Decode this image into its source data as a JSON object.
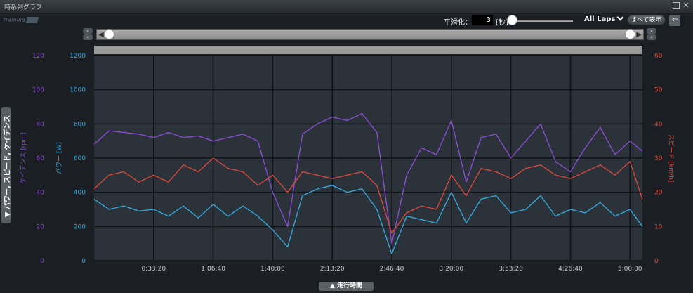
{
  "window": {
    "title": "時系列グラフ"
  },
  "logo": {
    "text": "Training"
  },
  "toolbar": {
    "smoothing_label": "平滑化：",
    "smoothing_value": "3",
    "smoothing_unit": "[秒]",
    "laps_label": "All Laps",
    "show_all_label": "すべて表示",
    "back_icon": "back-arrow-icon"
  },
  "range": {
    "pan_right": "»",
    "pan_left": "«",
    "left_arrow": "◀",
    "right_arrow": "▶"
  },
  "side_tab": {
    "label": "▼ パワー, スピード, ケイデンス"
  },
  "bottom_tab": {
    "label": "▲ 走行時間"
  },
  "colors": {
    "cadence": "#8d4fd6",
    "power": "#33aee0",
    "speed": "#e0493d",
    "bg": "#2c323a",
    "grid": "#0f1216"
  },
  "chart_data": {
    "type": "line",
    "xlabel": "走行時間",
    "x_unit": "seconds",
    "xlim": [
      0,
      18420
    ],
    "x_ticks": [
      "0:33:20",
      "1:06:40",
      "1:40:00",
      "2:13:20",
      "2:46:40",
      "3:20:00",
      "3:53:20",
      "4:26:40",
      "5:00:00"
    ],
    "x_tick_values": [
      2000,
      4000,
      6000,
      8000,
      10000,
      12000,
      14000,
      16000,
      18000
    ],
    "axes": {
      "cadence": {
        "label": "ケイデンス [rpm]",
        "ticks": [
          "0",
          "20",
          "40",
          "60",
          "80",
          "100",
          "120"
        ],
        "ylim": [
          0,
          120
        ]
      },
      "power": {
        "label": "パワー [W]",
        "ticks": [
          "0",
          "200",
          "400",
          "600",
          "800",
          "1000",
          "1200"
        ],
        "ylim": [
          0,
          1200
        ]
      },
      "speed": {
        "label": "スピード [km/h]",
        "ticks": [
          "0",
          "10",
          "20",
          "30",
          "40",
          "50",
          "60"
        ],
        "ylim": [
          0,
          60
        ]
      }
    },
    "series": [
      {
        "name": "ケイデンス",
        "axis": "cadence",
        "x": [
          0,
          500,
          1000,
          1500,
          2000,
          2500,
          3000,
          3500,
          4000,
          4500,
          5000,
          5500,
          6000,
          6500,
          7000,
          7500,
          8000,
          8500,
          9000,
          9500,
          10000,
          10500,
          11000,
          11500,
          12000,
          12500,
          13000,
          13500,
          14000,
          14500,
          15000,
          15500,
          16000,
          16500,
          17000,
          17500,
          18000,
          18420
        ],
        "values": [
          68,
          76,
          75,
          74,
          72,
          75,
          72,
          73,
          70,
          72,
          74,
          70,
          40,
          20,
          74,
          80,
          84,
          82,
          86,
          75,
          10,
          50,
          66,
          62,
          82,
          46,
          72,
          74,
          60,
          70,
          80,
          58,
          52,
          66,
          78,
          62,
          70,
          64
        ]
      },
      {
        "name": "パワー",
        "axis": "power",
        "x": [
          0,
          500,
          1000,
          1500,
          2000,
          2500,
          3000,
          3500,
          4000,
          4500,
          5000,
          5500,
          6000,
          6500,
          7000,
          7500,
          8000,
          8500,
          9000,
          9500,
          10000,
          10500,
          11000,
          11500,
          12000,
          12500,
          13000,
          13500,
          14000,
          14500,
          15000,
          15500,
          16000,
          16500,
          17000,
          17500,
          18000,
          18420
        ],
        "values": [
          360,
          300,
          320,
          290,
          300,
          260,
          320,
          250,
          330,
          260,
          320,
          260,
          180,
          80,
          380,
          420,
          440,
          400,
          420,
          300,
          40,
          260,
          240,
          220,
          400,
          220,
          360,
          380,
          280,
          300,
          380,
          260,
          300,
          280,
          340,
          260,
          300,
          200
        ]
      },
      {
        "name": "スピード",
        "axis": "speed",
        "x": [
          0,
          500,
          1000,
          1500,
          2000,
          2500,
          3000,
          3500,
          4000,
          4500,
          5000,
          5500,
          6000,
          6500,
          7000,
          7500,
          8000,
          8500,
          9000,
          9500,
          10000,
          10500,
          11000,
          11500,
          12000,
          12500,
          13000,
          13500,
          14000,
          14500,
          15000,
          15500,
          16000,
          16500,
          17000,
          17500,
          18000,
          18420
        ],
        "values": [
          21,
          25,
          26,
          23,
          25,
          23,
          28,
          26,
          30,
          27,
          26,
          22,
          25,
          20,
          26,
          25,
          24,
          25,
          26,
          22,
          8,
          14,
          16,
          15,
          25,
          19,
          27,
          26,
          24,
          27,
          28,
          25,
          24,
          26,
          28,
          25,
          29,
          18
        ]
      }
    ],
    "grid": true
  }
}
